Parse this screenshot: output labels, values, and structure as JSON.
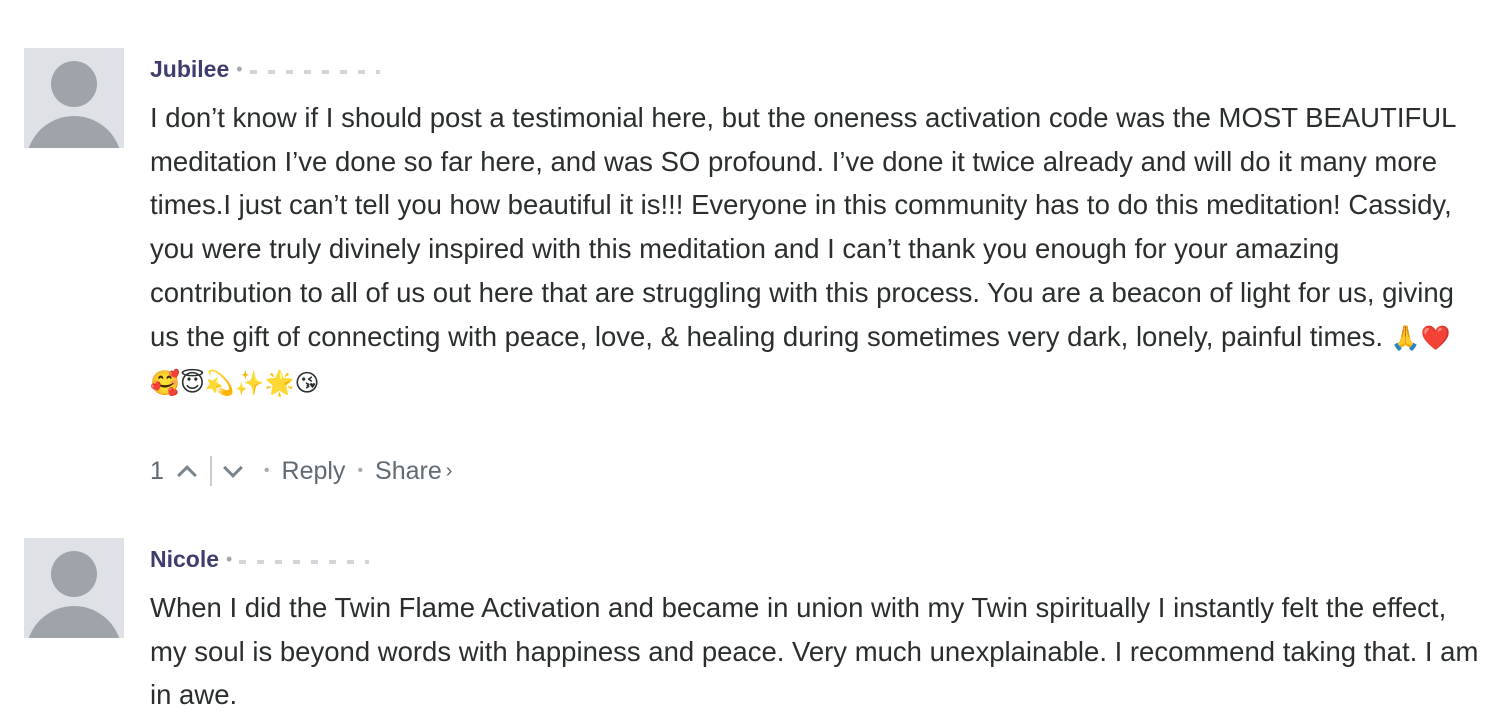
{
  "comments": [
    {
      "author": "Jubilee",
      "separator": "•",
      "text": "I don’t know if I should post a testimonial here, but the oneness activation code was the MOST BEAUTIFUL meditation I’ve done so far here, and was SO profound. I’ve done it twice already and will do it many more times.I just can’t tell you how beautiful it is!!! Everyone in this community has to do this meditation! Cassidy, you were truly divinely inspired with this meditation and I can’t thank you enough for your amazing contribution to all of us out here that are struggling with this process. You are a beacon of light for us, giving us the gift of connecting with peace, love, & healing during sometimes very dark, lonely, painful times.",
      "emoji": "🙏❤️ 🥰😇💫✨🌟😘",
      "votes": "1",
      "actions": {
        "reply": "Reply",
        "share": "Share",
        "share_arrow": "›",
        "dot": "•"
      }
    },
    {
      "author": "Nicole",
      "separator": "•",
      "text": "When I did the Twin Flame Activation and became in union with my Twin spiritually I instantly felt the effect, my soul is beyond words with happiness and peace. Very much unexplainable. I recommend taking that. I am in awe."
    }
  ]
}
